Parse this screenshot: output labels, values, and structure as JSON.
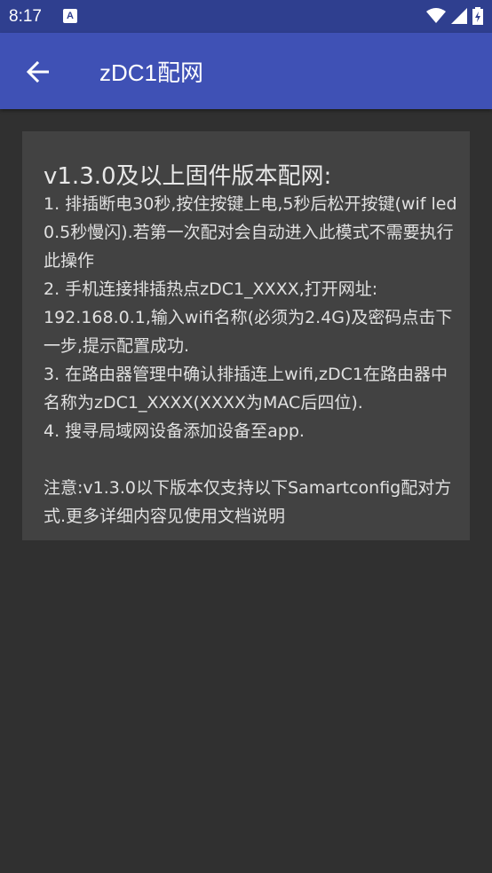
{
  "status_bar": {
    "time": "8:17",
    "notification_icon": "a-icon",
    "wifi_icon": "wifi-icon",
    "signal_icon": "signal-icon",
    "battery_icon": "battery-icon"
  },
  "app_bar": {
    "title": "zDC1配网",
    "back_icon": "arrow-back-icon",
    "color": "#3f51b5"
  },
  "card": {
    "title": "v1.3.0及以上固件版本配网:",
    "body": "1. 排插断电30秒,按住按键上电,5秒后松开按键(wif led 0.5秒慢闪).若第一次配对会自动进入此模式不需要执行此操作\n2. 手机连接排插热点zDC1_XXXX,打开网址: 192.168.0.1,输入wifi名称(必须为2.4G)及密码点击下一步,提示配置成功.\n 3. 在路由器管理中确认排插连上wifi,zDC1在路由器中名称为zDC1_XXXX(XXXX为MAC后四位).\n4. 搜寻局域网设备添加设备至app.\n\n 注意:v1.3.0以下版本仅支持以下Samartconfig配对方式.更多详细内容见使用文档说明"
  }
}
